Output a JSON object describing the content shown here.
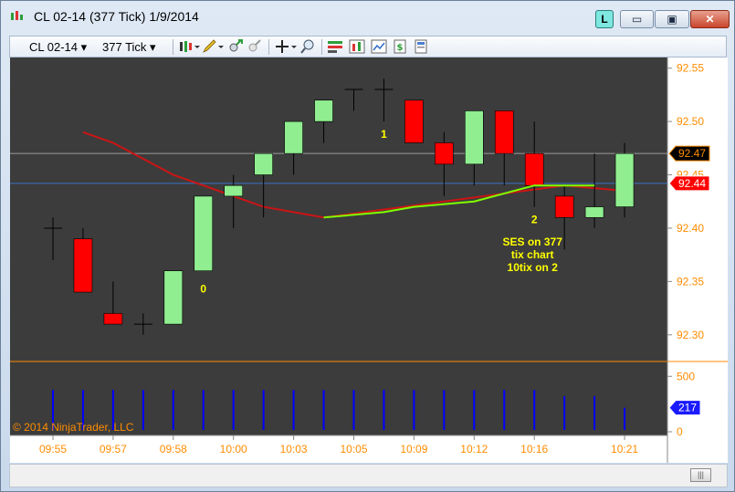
{
  "window": {
    "title": "CL 02-14 (377 Tick)  1/9/2014",
    "buttons": {
      "linked": "L",
      "minimize": "▭",
      "maximize": "▣",
      "close": "✕"
    }
  },
  "toolbar": {
    "instrument": "CL 02-14",
    "interval": "377 Tick",
    "icons": [
      "candlestick-style-icon",
      "draw-pencil-icon",
      "zoom-in-icon",
      "zoom-out-icon",
      "crosshair-icon",
      "magnifier-icon",
      "strategies-icon",
      "indicators-icon",
      "chart-properties-icon",
      "order-ticket-icon",
      "data-box-icon"
    ]
  },
  "colors": {
    "background": "#3c3c3c",
    "up_candle": "#90ee90",
    "down_candle": "#ff0000",
    "axis_text": "#ff8c00",
    "annotation": "#ffff00",
    "ses_line": "#7fff00",
    "ma_line": "#cc1414",
    "volume": "#0000ff"
  },
  "chart_data": {
    "type": "candlestick",
    "instrument": "CL 02-14",
    "interval": "377 Tick",
    "date": "1/9/2014",
    "price_ticks": [
      "92.55",
      "92.50",
      "92.45",
      "92.40",
      "92.35",
      "92.30"
    ],
    "price_axis_range": [
      92.275,
      92.56
    ],
    "volume_ticks": [
      "500",
      "0"
    ],
    "volume_axis_range": [
      0,
      560
    ],
    "time_labels": [
      "09:55",
      "09:57",
      "09:58",
      "10:00",
      "10:03",
      "10:05",
      "10:09",
      "10:12",
      "10:16",
      "10:21"
    ],
    "bars": [
      {
        "o": 92.4,
        "h": 92.41,
        "l": 92.37,
        "c": 92.4,
        "v": 377
      },
      {
        "o": 92.39,
        "h": 92.4,
        "l": 92.34,
        "c": 92.34,
        "v": 377
      },
      {
        "o": 92.32,
        "h": 92.35,
        "l": 92.31,
        "c": 92.31,
        "v": 377
      },
      {
        "o": 92.31,
        "h": 92.32,
        "l": 92.3,
        "c": 92.31,
        "v": 377
      },
      {
        "o": 92.31,
        "h": 92.36,
        "l": 92.31,
        "c": 92.36,
        "v": 377
      },
      {
        "o": 92.36,
        "h": 92.43,
        "l": 92.36,
        "c": 92.43,
        "v": 377
      },
      {
        "o": 92.43,
        "h": 92.45,
        "l": 92.4,
        "c": 92.44,
        "v": 377
      },
      {
        "o": 92.45,
        "h": 92.47,
        "l": 92.41,
        "c": 92.47,
        "v": 377
      },
      {
        "o": 92.47,
        "h": 92.5,
        "l": 92.45,
        "c": 92.5,
        "v": 377
      },
      {
        "o": 92.5,
        "h": 92.52,
        "l": 92.48,
        "c": 92.52,
        "v": 377
      },
      {
        "o": 92.53,
        "h": 92.53,
        "l": 92.51,
        "c": 92.53,
        "v": 377
      },
      {
        "o": 92.53,
        "h": 92.54,
        "l": 92.5,
        "c": 92.53,
        "v": 377
      },
      {
        "o": 92.52,
        "h": 92.52,
        "l": 92.48,
        "c": 92.48,
        "v": 377
      },
      {
        "o": 92.48,
        "h": 92.49,
        "l": 92.43,
        "c": 92.46,
        "v": 377
      },
      {
        "o": 92.46,
        "h": 92.51,
        "l": 92.44,
        "c": 92.51,
        "v": 377
      },
      {
        "o": 92.51,
        "h": 92.51,
        "l": 92.44,
        "c": 92.47,
        "v": 377
      },
      {
        "o": 92.47,
        "h": 92.5,
        "l": 92.42,
        "c": 92.44,
        "v": 377
      },
      {
        "o": 92.43,
        "h": 92.44,
        "l": 92.38,
        "c": 92.41,
        "v": 320
      },
      {
        "o": 92.41,
        "h": 92.47,
        "l": 92.4,
        "c": 92.42,
        "v": 320
      },
      {
        "o": 92.42,
        "h": 92.48,
        "l": 92.41,
        "c": 92.47,
        "v": 217
      }
    ],
    "ma_line": [
      92.49,
      92.48,
      92.465,
      92.45,
      92.44,
      92.43,
      92.42,
      92.415,
      92.41
    ],
    "ma_line_start_index": 1,
    "ma_line_end_tail": [
      [
        17,
        92.44
      ],
      [
        19,
        92.435
      ]
    ],
    "ses_line": [
      [
        9,
        92.41
      ],
      [
        11,
        92.415
      ],
      [
        12,
        92.42
      ],
      [
        14,
        92.425
      ],
      [
        16,
        92.44
      ],
      [
        18,
        92.44
      ]
    ],
    "price_markers": [
      {
        "label": "92.47",
        "value": 92.47,
        "color": "#000000",
        "line": "#9a9a9a"
      },
      {
        "label": "92.44",
        "value": 92.442,
        "color": "#ff0000",
        "line": "#3a73c9"
      }
    ],
    "volume_marker": {
      "label": "217",
      "value": 217
    },
    "annotations": [
      {
        "text": "0",
        "bar": 5
      },
      {
        "text": "1",
        "bar": 11
      },
      {
        "text": "2",
        "bar": 16
      }
    ],
    "note_lines": [
      "SES on 377",
      "tix chart",
      "10tix on 2"
    ],
    "copyright": "© 2014 NinjaTrader, LLC"
  }
}
